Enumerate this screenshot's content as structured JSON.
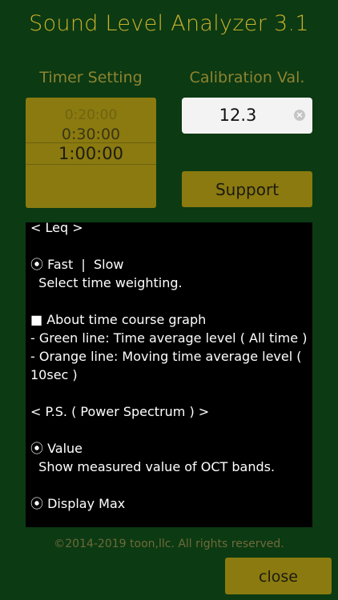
{
  "app_title": "Sound Level Analyzer 3.1",
  "timer": {
    "label": "Timer Setting",
    "options": [
      "0:20:00",
      "0:30:00",
      "1:00:00"
    ],
    "selected": "1:00:00"
  },
  "calibration": {
    "label": "Calibration Val.",
    "value": "12.3",
    "clear_icon": "clear-icon"
  },
  "support_label": "Support",
  "help": {
    "lines": [
      "< Leq >",
      "",
      "⦿ Fast  |  Slow",
      "  Select time weighting.",
      "",
      "■ About time course graph",
      " - Green line: Time average level ( All time )",
      " - Orange line: Moving time average level ( 10sec )",
      "",
      "< P.S. ( Power Spectrum ) >",
      "",
      "⦿ Value",
      "  Show measured value of OCT bands.",
      "",
      "⦿ Display Max"
    ]
  },
  "footer": "©2014-2019 toon,llc. All rights reserved.",
  "close_label": "close",
  "colors": {
    "background": "#0c3a13",
    "accent": "#8a7a10",
    "title": "#c9b12c"
  }
}
